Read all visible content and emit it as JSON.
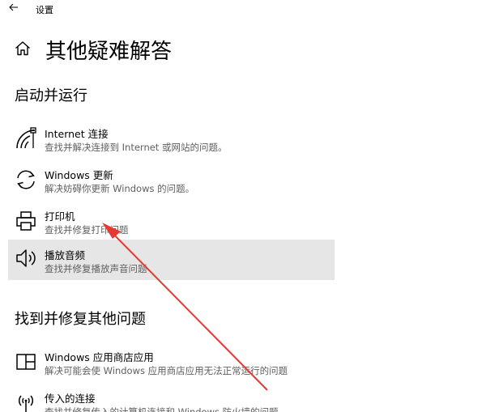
{
  "window": {
    "title": "设置"
  },
  "page": {
    "title": "其他疑难解答"
  },
  "sections": [
    {
      "heading": "启动并运行",
      "items": [
        {
          "icon": "wifi-signal-icon",
          "title": "Internet 连接",
          "desc": "查找并解决连接到 Internet 或网站的问题。"
        },
        {
          "icon": "refresh-icon",
          "title": "Windows 更新",
          "desc": "解决妨碍你更新 Windows 的问题。"
        },
        {
          "icon": "printer-icon",
          "title": "打印机",
          "desc": "查找并修复打印问题"
        },
        {
          "icon": "speaker-icon",
          "title": "播放音频",
          "desc": "查找并修复播放声音问题"
        }
      ]
    },
    {
      "heading": "找到并修复其他问题",
      "items": [
        {
          "icon": "store-app-icon",
          "title": "Windows 应用商店应用",
          "desc": "解决可能会使 Windows 应用商店应用无法正常运行的问题"
        },
        {
          "icon": "antenna-icon",
          "title": "传入的连接",
          "desc": "查找并修复传入的计算机连接和 Windows 防火墙的问题。"
        }
      ]
    }
  ],
  "colors": {
    "highlight": "#e6e6e6",
    "description": "#5f5f5f",
    "annotation": "#e53935"
  }
}
